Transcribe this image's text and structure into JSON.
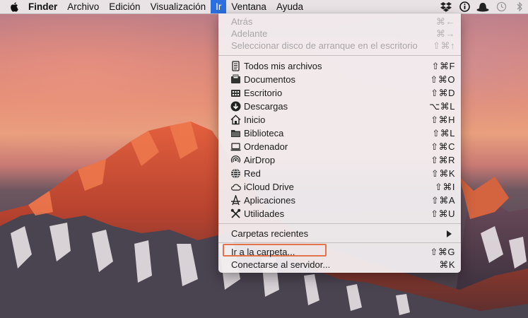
{
  "menubar": {
    "apple_icon": "apple-logo-icon",
    "items": [
      {
        "label": "Finder",
        "bold": true
      },
      {
        "label": "Archivo"
      },
      {
        "label": "Edición"
      },
      {
        "label": "Visualización"
      },
      {
        "label": "Ir",
        "active": true
      },
      {
        "label": "Ventana"
      },
      {
        "label": "Ayuda"
      }
    ],
    "status_icons": [
      "dropbox-icon",
      "info-icon",
      "hat-icon",
      "time-machine-icon",
      "bluetooth-icon"
    ]
  },
  "go_menu": {
    "history": [
      {
        "label": "Atrás",
        "shortcut": "⌘←",
        "enabled": false
      },
      {
        "label": "Adelante",
        "shortcut": "⌘→",
        "enabled": false
      },
      {
        "label": "Seleccionar disco de arranque en el escritorio",
        "shortcut": "⇧⌘↑",
        "enabled": false
      }
    ],
    "places": [
      {
        "label": "Todos mis archivos",
        "shortcut": "⇧⌘F",
        "icon": "all-files-icon"
      },
      {
        "label": "Documentos",
        "shortcut": "⇧⌘O",
        "icon": "documents-icon"
      },
      {
        "label": "Escritorio",
        "shortcut": "⇧⌘D",
        "icon": "desktop-icon"
      },
      {
        "label": "Descargas",
        "shortcut": "⌥⌘L",
        "icon": "downloads-icon"
      },
      {
        "label": "Inicio",
        "shortcut": "⇧⌘H",
        "icon": "home-icon"
      },
      {
        "label": "Biblioteca",
        "shortcut": "⇧⌘L",
        "icon": "library-folder-icon"
      },
      {
        "label": "Ordenador",
        "shortcut": "⇧⌘C",
        "icon": "computer-icon"
      },
      {
        "label": "AirDrop",
        "shortcut": "⇧⌘R",
        "icon": "airdrop-icon"
      },
      {
        "label": "Red",
        "shortcut": "⇧⌘K",
        "icon": "network-icon"
      },
      {
        "label": "iCloud Drive",
        "shortcut": "⇧⌘I",
        "icon": "icloud-icon"
      },
      {
        "label": "Aplicaciones",
        "shortcut": "⇧⌘A",
        "icon": "applications-icon"
      },
      {
        "label": "Utilidades",
        "shortcut": "⇧⌘U",
        "icon": "utilities-icon"
      }
    ],
    "recent": {
      "label": "Carpetas recientes",
      "icon": "submenu-arrow-icon"
    },
    "folder": [
      {
        "label": "Ir a la carpeta...",
        "shortcut": "⇧⌘G",
        "highlighted": true
      },
      {
        "label": "Conectarse al servidor...",
        "shortcut": "⌘K"
      }
    ],
    "highlight_color": "#e0744a"
  }
}
